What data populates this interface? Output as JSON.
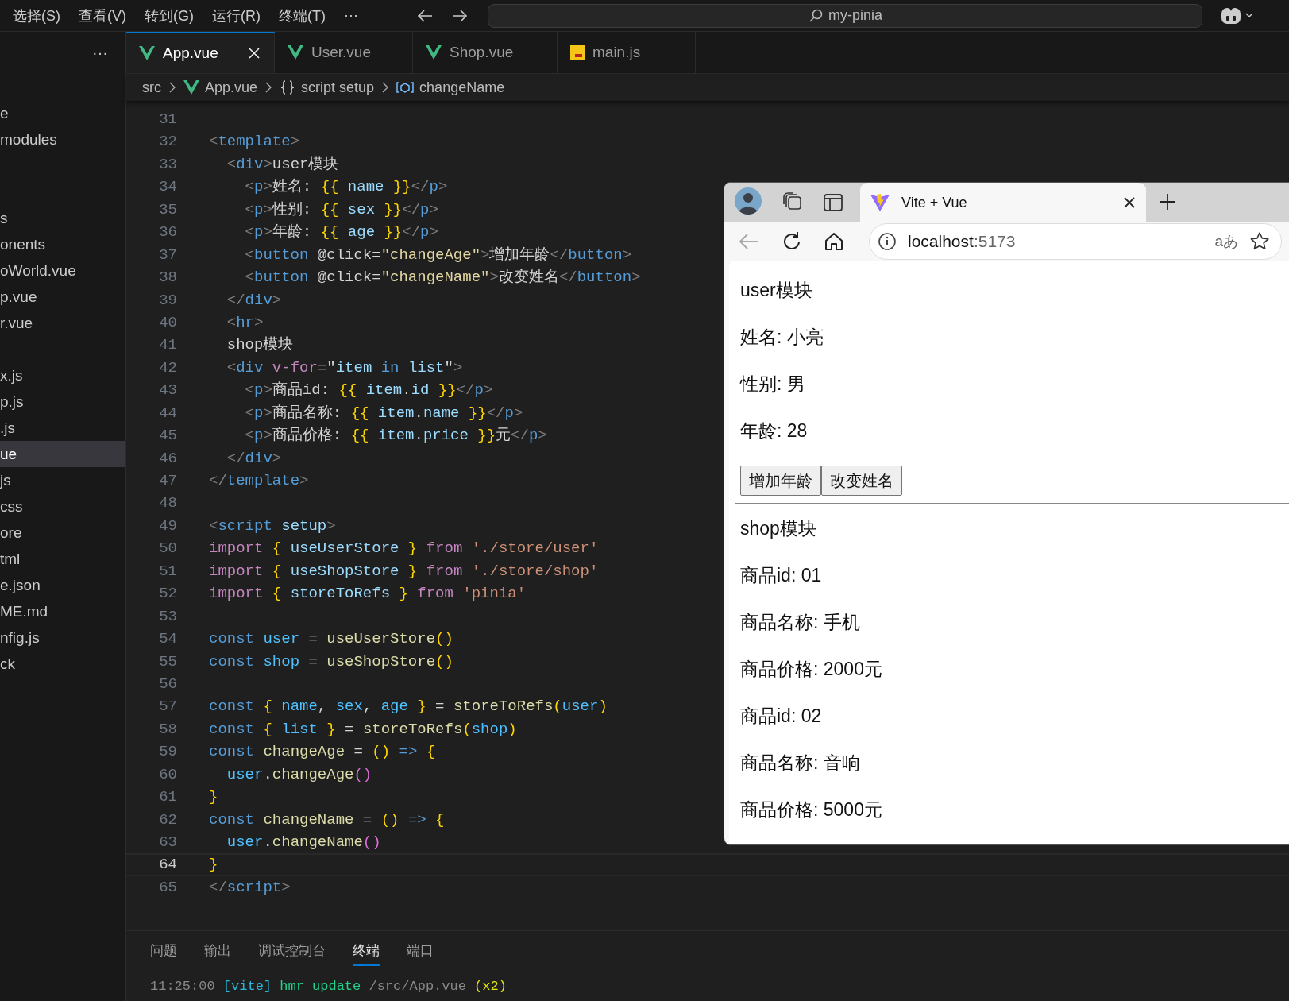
{
  "menu_bar": {
    "items": [
      "选择(S)",
      "查看(V)",
      "转到(G)",
      "运行(R)",
      "终端(T)",
      "···"
    ],
    "search": {
      "value": "my-pinia"
    }
  },
  "sidebar": {
    "more": "···",
    "groups": [
      [
        {
          "label": "e",
          "selected": false
        },
        {
          "label": "modules",
          "selected": false
        }
      ],
      [
        {
          "label": "s",
          "selected": false
        },
        {
          "label": "onents",
          "selected": false
        },
        {
          "label": "oWorld.vue",
          "selected": false
        },
        {
          "label": "p.vue",
          "selected": false
        },
        {
          "label": "r.vue",
          "selected": false
        }
      ],
      [
        {
          "label": "x.js",
          "selected": false
        },
        {
          "label": "p.js",
          "selected": false
        },
        {
          "label": ".js",
          "selected": false
        },
        {
          "label": "ue",
          "selected": true
        },
        {
          "label": "js",
          "selected": false
        },
        {
          "label": "css",
          "selected": false
        },
        {
          "label": "ore",
          "selected": false
        },
        {
          "label": "tml",
          "selected": false
        },
        {
          "label": "e.json",
          "selected": false
        },
        {
          "label": "ME.md",
          "selected": false
        },
        {
          "label": "nfig.js",
          "selected": false
        },
        {
          "label": "ck",
          "selected": false
        }
      ]
    ]
  },
  "editor_tabs": [
    {
      "label": "App.vue",
      "kind": "vue",
      "selected": true
    },
    {
      "label": "User.vue",
      "kind": "vue",
      "selected": false
    },
    {
      "label": "Shop.vue",
      "kind": "vue",
      "selected": false
    },
    {
      "label": "main.js",
      "kind": "js",
      "selected": false
    }
  ],
  "breadcrumb": [
    {
      "label": "src",
      "kind": "folder"
    },
    {
      "label": "App.vue",
      "kind": "vue"
    },
    {
      "label": "script setup",
      "kind": "braces"
    },
    {
      "label": "changeName",
      "kind": "symbol"
    }
  ],
  "code": {
    "lines": [
      {
        "number": "31",
        "current": false
      },
      {
        "number": "32",
        "current": false,
        "tokens": [
          {
            "kind": "punct",
            "text": "<"
          },
          {
            "kind": "tag",
            "text": "template"
          },
          {
            "kind": "punct",
            "text": ">"
          }
        ]
      },
      {
        "number": "33",
        "current": false,
        "tokens": [
          {
            "kind": "punct",
            "text": "  <"
          },
          {
            "kind": "tag",
            "text": "div"
          },
          {
            "kind": "punct",
            "text": ">"
          },
          {
            "kind": "text",
            "text": "user模块"
          }
        ]
      },
      {
        "number": "34",
        "current": false,
        "tokens": [
          {
            "kind": "punct",
            "text": "    <"
          },
          {
            "kind": "tag",
            "text": "p"
          },
          {
            "kind": "punct",
            "text": ">"
          },
          {
            "kind": "text",
            "text": "姓名: "
          },
          {
            "kind": "brace",
            "text": "{{"
          },
          {
            "kind": "var",
            "text": " name "
          },
          {
            "kind": "brace",
            "text": "}}"
          },
          {
            "kind": "punct",
            "text": "</"
          },
          {
            "kind": "tag",
            "text": "p"
          },
          {
            "kind": "punct",
            "text": ">"
          }
        ]
      },
      {
        "number": "35",
        "current": false,
        "tokens": [
          {
            "kind": "punct",
            "text": "    <"
          },
          {
            "kind": "tag",
            "text": "p"
          },
          {
            "kind": "punct",
            "text": ">"
          },
          {
            "kind": "text",
            "text": "性别: "
          },
          {
            "kind": "brace",
            "text": "{{"
          },
          {
            "kind": "var",
            "text": " sex "
          },
          {
            "kind": "brace",
            "text": "}}"
          },
          {
            "kind": "punct",
            "text": "</"
          },
          {
            "kind": "tag",
            "text": "p"
          },
          {
            "kind": "punct",
            "text": ">"
          }
        ]
      },
      {
        "number": "36",
        "current": false,
        "tokens": [
          {
            "kind": "punct",
            "text": "    <"
          },
          {
            "kind": "tag",
            "text": "p"
          },
          {
            "kind": "punct",
            "text": ">"
          },
          {
            "kind": "text",
            "text": "年龄: "
          },
          {
            "kind": "brace",
            "text": "{{"
          },
          {
            "kind": "var",
            "text": " age "
          },
          {
            "kind": "brace",
            "text": "}}"
          },
          {
            "kind": "punct",
            "text": "</"
          },
          {
            "kind": "tag",
            "text": "p"
          },
          {
            "kind": "punct",
            "text": ">"
          }
        ]
      },
      {
        "number": "37",
        "current": false,
        "tokens": [
          {
            "kind": "punct",
            "text": "    <"
          },
          {
            "kind": "tag",
            "text": "button"
          },
          {
            "kind": "text",
            "text": " @click="
          },
          {
            "kind": "attrvalue",
            "text": "\"changeAge\""
          },
          {
            "kind": "punct",
            "text": ">"
          },
          {
            "kind": "text",
            "text": "增加年龄"
          },
          {
            "kind": "punct",
            "text": "</"
          },
          {
            "kind": "tag",
            "text": "button"
          },
          {
            "kind": "punct",
            "text": ">"
          }
        ]
      },
      {
        "number": "38",
        "current": false,
        "tokens": [
          {
            "kind": "punct",
            "text": "    <"
          },
          {
            "kind": "tag",
            "text": "button"
          },
          {
            "kind": "text",
            "text": " @click="
          },
          {
            "kind": "attrvalue",
            "text": "\"changeName\""
          },
          {
            "kind": "punct",
            "text": ">"
          },
          {
            "kind": "text",
            "text": "改变姓名"
          },
          {
            "kind": "punct",
            "text": "</"
          },
          {
            "kind": "tag",
            "text": "button"
          },
          {
            "kind": "punct",
            "text": ">"
          }
        ]
      },
      {
        "number": "39",
        "current": false,
        "tokens": [
          {
            "kind": "punct",
            "text": "  </"
          },
          {
            "kind": "tag",
            "text": "div"
          },
          {
            "kind": "punct",
            "text": ">"
          }
        ]
      },
      {
        "number": "40",
        "current": false,
        "tokens": [
          {
            "kind": "punct",
            "text": "  <"
          },
          {
            "kind": "tag",
            "text": "hr"
          },
          {
            "kind": "punct",
            "text": ">"
          }
        ]
      },
      {
        "number": "41",
        "current": false,
        "tokens": [
          {
            "kind": "text",
            "text": "  shop模块"
          }
        ]
      },
      {
        "number": "42",
        "current": false,
        "tokens": [
          {
            "kind": "punct",
            "text": "  <"
          },
          {
            "kind": "tag",
            "text": "div"
          },
          {
            "kind": "directive",
            "text": " v-for"
          },
          {
            "kind": "text",
            "text": "=\""
          },
          {
            "kind": "var",
            "text": "item "
          },
          {
            "kind": "tag",
            "text": "in"
          },
          {
            "kind": "var",
            "text": " list"
          },
          {
            "kind": "text",
            "text": "\""
          },
          {
            "kind": "punct",
            "text": ">"
          }
        ]
      },
      {
        "number": "43",
        "current": false,
        "tokens": [
          {
            "kind": "punct",
            "text": "    <"
          },
          {
            "kind": "tag",
            "text": "p"
          },
          {
            "kind": "punct",
            "text": ">"
          },
          {
            "kind": "text",
            "text": "商品id: "
          },
          {
            "kind": "brace",
            "text": "{{"
          },
          {
            "kind": "var",
            "text": " item"
          },
          {
            "kind": "text",
            "text": "."
          },
          {
            "kind": "var",
            "text": "id "
          },
          {
            "kind": "brace",
            "text": "}}"
          },
          {
            "kind": "punct",
            "text": "</"
          },
          {
            "kind": "tag",
            "text": "p"
          },
          {
            "kind": "punct",
            "text": ">"
          }
        ]
      },
      {
        "number": "44",
        "current": false,
        "tokens": [
          {
            "kind": "punct",
            "text": "    <"
          },
          {
            "kind": "tag",
            "text": "p"
          },
          {
            "kind": "punct",
            "text": ">"
          },
          {
            "kind": "text",
            "text": "商品名称: "
          },
          {
            "kind": "brace",
            "text": "{{"
          },
          {
            "kind": "var",
            "text": " item"
          },
          {
            "kind": "text",
            "text": "."
          },
          {
            "kind": "var",
            "text": "name "
          },
          {
            "kind": "brace",
            "text": "}}"
          },
          {
            "kind": "punct",
            "text": "</"
          },
          {
            "kind": "tag",
            "text": "p"
          },
          {
            "kind": "punct",
            "text": ">"
          }
        ]
      },
      {
        "number": "45",
        "current": false,
        "tokens": [
          {
            "kind": "punct",
            "text": "    <"
          },
          {
            "kind": "tag",
            "text": "p"
          },
          {
            "kind": "punct",
            "text": ">"
          },
          {
            "kind": "text",
            "text": "商品价格: "
          },
          {
            "kind": "brace",
            "text": "{{"
          },
          {
            "kind": "var",
            "text": " item"
          },
          {
            "kind": "text",
            "text": "."
          },
          {
            "kind": "var",
            "text": "price "
          },
          {
            "kind": "brace",
            "text": "}}"
          },
          {
            "kind": "text",
            "text": "元"
          },
          {
            "kind": "punct",
            "text": "</"
          },
          {
            "kind": "tag",
            "text": "p"
          },
          {
            "kind": "punct",
            "text": ">"
          }
        ]
      },
      {
        "number": "46",
        "current": false,
        "tokens": [
          {
            "kind": "punct",
            "text": "  </"
          },
          {
            "kind": "tag",
            "text": "div"
          },
          {
            "kind": "punct",
            "text": ">"
          }
        ]
      },
      {
        "number": "47",
        "current": false,
        "tokens": [
          {
            "kind": "punct",
            "text": "</"
          },
          {
            "kind": "tag",
            "text": "template"
          },
          {
            "kind": "punct",
            "text": ">"
          }
        ]
      },
      {
        "number": "48",
        "current": false
      },
      {
        "number": "49",
        "current": false,
        "tokens": [
          {
            "kind": "punct",
            "text": "<"
          },
          {
            "kind": "tag",
            "text": "script"
          },
          {
            "kind": "var",
            "text": " setup"
          },
          {
            "kind": "punct",
            "text": ">"
          }
        ]
      },
      {
        "number": "50",
        "current": false,
        "tokens": [
          {
            "kind": "keyword",
            "text": "import "
          },
          {
            "kind": "brace",
            "text": "{ "
          },
          {
            "kind": "var",
            "text": "useUserStore"
          },
          {
            "kind": "brace",
            "text": " }"
          },
          {
            "kind": "keyword",
            "text": " from "
          },
          {
            "kind": "string",
            "text": "'./store/user'"
          }
        ]
      },
      {
        "number": "51",
        "current": false,
        "tokens": [
          {
            "kind": "keyword",
            "text": "import "
          },
          {
            "kind": "brace",
            "text": "{ "
          },
          {
            "kind": "var",
            "text": "useShopStore"
          },
          {
            "kind": "brace",
            "text": " }"
          },
          {
            "kind": "keyword",
            "text": " from "
          },
          {
            "kind": "string",
            "text": "'./store/shop'"
          }
        ]
      },
      {
        "number": "52",
        "current": false,
        "tokens": [
          {
            "kind": "keyword",
            "text": "import "
          },
          {
            "kind": "brace",
            "text": "{ "
          },
          {
            "kind": "var",
            "text": "storeToRefs"
          },
          {
            "kind": "brace",
            "text": " }"
          },
          {
            "kind": "keyword",
            "text": " from "
          },
          {
            "kind": "string",
            "text": "'pinia'"
          }
        ]
      },
      {
        "number": "53",
        "current": false
      },
      {
        "number": "54",
        "current": false,
        "tokens": [
          {
            "kind": "storage",
            "text": "const "
          },
          {
            "kind": "const",
            "text": "user"
          },
          {
            "kind": "text",
            "text": " = "
          },
          {
            "kind": "func",
            "text": "useUserStore"
          },
          {
            "kind": "brace",
            "text": "()"
          }
        ]
      },
      {
        "number": "55",
        "current": false,
        "tokens": [
          {
            "kind": "storage",
            "text": "const "
          },
          {
            "kind": "const",
            "text": "shop"
          },
          {
            "kind": "text",
            "text": " = "
          },
          {
            "kind": "func",
            "text": "useShopStore"
          },
          {
            "kind": "brace",
            "text": "()"
          }
        ]
      },
      {
        "number": "56",
        "current": false
      },
      {
        "number": "57",
        "current": false,
        "tokens": [
          {
            "kind": "storage",
            "text": "const "
          },
          {
            "kind": "brace",
            "text": "{ "
          },
          {
            "kind": "const",
            "text": "name"
          },
          {
            "kind": "text",
            "text": ", "
          },
          {
            "kind": "const",
            "text": "sex"
          },
          {
            "kind": "text",
            "text": ", "
          },
          {
            "kind": "const",
            "text": "age"
          },
          {
            "kind": "brace",
            "text": " }"
          },
          {
            "kind": "text",
            "text": " = "
          },
          {
            "kind": "func",
            "text": "storeToRefs"
          },
          {
            "kind": "brace",
            "text": "("
          },
          {
            "kind": "const",
            "text": "user"
          },
          {
            "kind": "brace",
            "text": ")"
          }
        ]
      },
      {
        "number": "58",
        "current": false,
        "tokens": [
          {
            "kind": "storage",
            "text": "const "
          },
          {
            "kind": "brace",
            "text": "{ "
          },
          {
            "kind": "const",
            "text": "list"
          },
          {
            "kind": "brace",
            "text": " }"
          },
          {
            "kind": "text",
            "text": " = "
          },
          {
            "kind": "func",
            "text": "storeToRefs"
          },
          {
            "kind": "brace",
            "text": "("
          },
          {
            "kind": "const",
            "text": "shop"
          },
          {
            "kind": "brace",
            "text": ")"
          }
        ]
      },
      {
        "number": "59",
        "current": false,
        "tokens": [
          {
            "kind": "storage",
            "text": "const "
          },
          {
            "kind": "func",
            "text": "changeAge"
          },
          {
            "kind": "text",
            "text": " = "
          },
          {
            "kind": "brace",
            "text": "()"
          },
          {
            "kind": "storage",
            "text": " =>"
          },
          {
            "kind": "brace",
            "text": " {"
          }
        ]
      },
      {
        "number": "60",
        "current": false,
        "tokens": [
          {
            "kind": "const",
            "text": "  user"
          },
          {
            "kind": "text",
            "text": "."
          },
          {
            "kind": "func",
            "text": "changeAge"
          },
          {
            "kind": "paren",
            "text": "()"
          }
        ]
      },
      {
        "number": "61",
        "current": false,
        "tokens": [
          {
            "kind": "brace",
            "text": "}"
          }
        ]
      },
      {
        "number": "62",
        "current": false,
        "tokens": [
          {
            "kind": "storage",
            "text": "const "
          },
          {
            "kind": "func",
            "text": "changeName"
          },
          {
            "kind": "text",
            "text": " = "
          },
          {
            "kind": "brace",
            "text": "()"
          },
          {
            "kind": "storage",
            "text": " =>"
          },
          {
            "kind": "brace",
            "text": " {"
          }
        ]
      },
      {
        "number": "63",
        "current": false,
        "tokens": [
          {
            "kind": "const",
            "text": "  user"
          },
          {
            "kind": "text",
            "text": "."
          },
          {
            "kind": "func",
            "text": "changeName"
          },
          {
            "kind": "paren",
            "text": "()"
          }
        ]
      },
      {
        "number": "64",
        "current": true,
        "tokens": [
          {
            "kind": "brace",
            "text": "}"
          }
        ]
      },
      {
        "number": "65",
        "current": false,
        "tokens": [
          {
            "kind": "punct",
            "text": "</"
          },
          {
            "kind": "tag",
            "text": "script"
          },
          {
            "kind": "punct",
            "text": ">"
          }
        ]
      }
    ]
  },
  "panel": {
    "tabs": [
      {
        "label": "问题",
        "selected": false
      },
      {
        "label": "输出",
        "selected": false
      },
      {
        "label": "调试控制台",
        "selected": false
      },
      {
        "label": "终端",
        "selected": true
      },
      {
        "label": "端口",
        "selected": false
      }
    ],
    "terminal": [
      {
        "kind": "time",
        "text": "11:25:00 "
      },
      {
        "kind": "tag",
        "text": "[vite]"
      },
      {
        "kind": "action",
        "text": " hmr update"
      },
      {
        "kind": "path",
        "text": " /src/App.vue"
      },
      {
        "kind": "count",
        "text": " (x2)"
      }
    ]
  },
  "browser": {
    "tab": {
      "title": "Vite + Vue"
    },
    "back_disabled": true,
    "url": {
      "host": "localhost",
      "port": ":5173"
    },
    "translate": "aあ",
    "page": {
      "user_title": "user模块",
      "user_fields": [
        "姓名: 小亮",
        "性别: 男",
        "年龄: 28"
      ],
      "buttons": [
        "增加年龄",
        "改变姓名"
      ],
      "shop_title": "shop模块",
      "products": [
        [
          "商品id: 01",
          "商品名称: 手机",
          "商品价格: 2000元"
        ],
        [
          "商品id: 02",
          "商品名称: 音响",
          "商品价格: 5000元"
        ]
      ]
    }
  }
}
